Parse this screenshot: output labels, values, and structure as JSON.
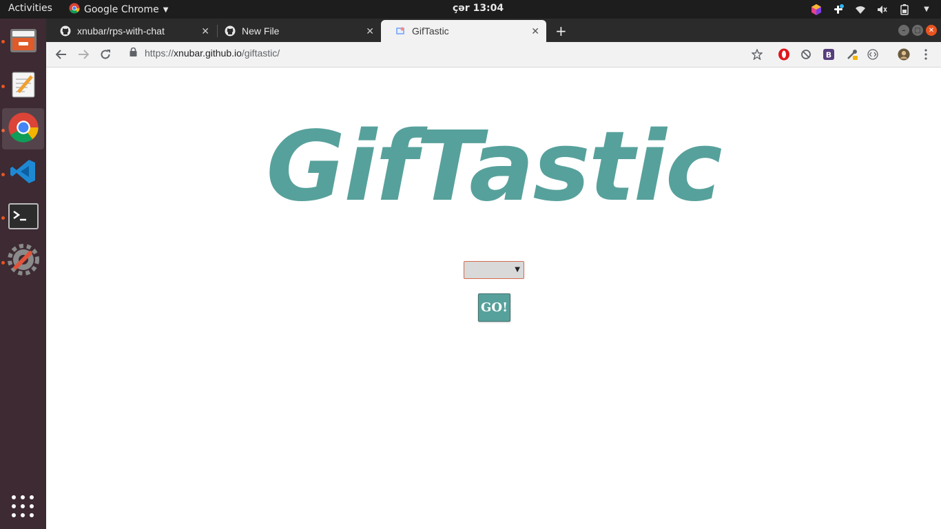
{
  "topbar": {
    "activities_label": "Activities",
    "app_name": "Google Chrome",
    "clock": "çər 13:04"
  },
  "dock": {
    "items": [
      {
        "name": "Files"
      },
      {
        "name": "Text Editor"
      },
      {
        "name": "Google Chrome"
      },
      {
        "name": "Visual Studio Code"
      },
      {
        "name": "Terminal"
      },
      {
        "name": "Settings"
      }
    ]
  },
  "browser": {
    "tabs": [
      {
        "label": "xnubar/rps-with-chat",
        "icon": "github-icon",
        "close": "✕"
      },
      {
        "label": "New File",
        "icon": "github-icon",
        "close": "✕"
      },
      {
        "label": "GifTastic",
        "icon": "giftastic-favicon",
        "close": "✕"
      }
    ],
    "newtab_label": "+",
    "url": {
      "scheme": "https://",
      "host": "xnubar.github.io",
      "path": "/giftastic/"
    }
  },
  "page": {
    "title": "GifTastic",
    "select_value": "",
    "go_label": "GO!"
  },
  "colors": {
    "accent": "#57a19c",
    "ubuntu_orange": "#e95420",
    "dock_bg": "#3d2a33"
  }
}
